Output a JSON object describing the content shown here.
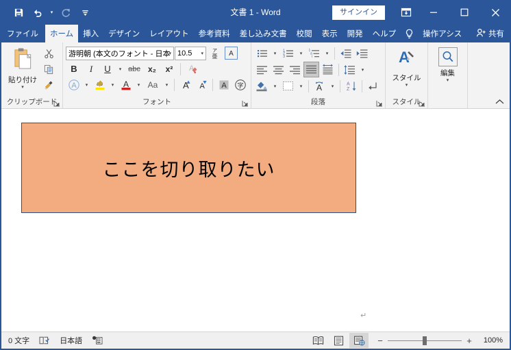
{
  "titlebar": {
    "document_title": "文書 1  -  Word",
    "signin_label": "サインイン",
    "quick_access": [
      {
        "name": "save",
        "icon": "save-icon"
      },
      {
        "name": "undo",
        "icon": "undo-icon"
      },
      {
        "name": "redo",
        "icon": "redo-icon"
      },
      {
        "name": "customize-quick-access",
        "icon": "chevron-down-icon"
      }
    ],
    "window_buttons": {
      "ribbon_display": "ribbon-display-options-icon",
      "minimize": "–",
      "maximize": "❐",
      "close": "✕"
    }
  },
  "tabs": [
    {
      "label": "ファイル",
      "active": false
    },
    {
      "label": "ホーム",
      "active": true
    },
    {
      "label": "挿入",
      "active": false
    },
    {
      "label": "デザイン",
      "active": false
    },
    {
      "label": "レイアウト",
      "active": false
    },
    {
      "label": "参考資料",
      "active": false
    },
    {
      "label": "差し込み文書",
      "active": false
    },
    {
      "label": "校閲",
      "active": false
    },
    {
      "label": "表示",
      "active": false
    },
    {
      "label": "開発",
      "active": false
    },
    {
      "label": "ヘルプ",
      "active": false
    }
  ],
  "tell_me": {
    "label": "操作アシス",
    "icon": "lightbulb-icon"
  },
  "share": {
    "label": "共有",
    "icon": "share-person-icon"
  },
  "ribbon": {
    "groups": [
      {
        "name": "clipboard",
        "label": "クリップボード",
        "paste_label": "貼り付け",
        "buttons": [
          {
            "name": "cut",
            "icon": "scissors-icon"
          },
          {
            "name": "copy",
            "icon": "copy-icon"
          },
          {
            "name": "format-painter",
            "icon": "format-painter-icon"
          }
        ]
      },
      {
        "name": "font",
        "label": "フォント",
        "font_name": "游明朝 (本文のフォント - 日本",
        "font_size": "10.5",
        "buttons": [
          {
            "name": "phonetic-guide",
            "label": "ア亜"
          },
          {
            "name": "character-border",
            "label": "A"
          },
          {
            "name": "bold",
            "label": "B"
          },
          {
            "name": "italic",
            "label": "I"
          },
          {
            "name": "underline",
            "label": "U"
          },
          {
            "name": "strikethrough",
            "label": "abc"
          },
          {
            "name": "subscript",
            "label": "x₂"
          },
          {
            "name": "superscript",
            "label": "x²"
          },
          {
            "name": "clear-formatting",
            "label": "A"
          },
          {
            "name": "text-effects",
            "label": "A"
          },
          {
            "name": "text-highlight-color",
            "label": "ab"
          },
          {
            "name": "font-color",
            "label": "A"
          },
          {
            "name": "change-case",
            "label": "Aa"
          },
          {
            "name": "grow-font",
            "label": "A"
          },
          {
            "name": "shrink-font",
            "label": "A"
          },
          {
            "name": "character-shading",
            "label": "A"
          },
          {
            "name": "enclose-characters",
            "label": "字"
          }
        ]
      },
      {
        "name": "paragraph",
        "label": "段落",
        "buttons": [
          {
            "name": "bullets"
          },
          {
            "name": "numbering"
          },
          {
            "name": "multilevel-list"
          },
          {
            "name": "decrease-indent"
          },
          {
            "name": "increase-indent"
          },
          {
            "name": "align-left"
          },
          {
            "name": "align-center"
          },
          {
            "name": "align-right"
          },
          {
            "name": "justify",
            "selected": true
          },
          {
            "name": "distributed"
          },
          {
            "name": "line-spacing"
          },
          {
            "name": "shading"
          },
          {
            "name": "borders"
          },
          {
            "name": "phonetic-format"
          },
          {
            "name": "sort"
          },
          {
            "name": "show-formatting-marks"
          }
        ]
      },
      {
        "name": "styles",
        "label": "スタイル",
        "button_label": "スタイル"
      },
      {
        "name": "editing",
        "label": "",
        "button_label": "編集"
      }
    ],
    "collapse_icon": "chevron-up-icon"
  },
  "document": {
    "textbox_text": "ここを切り取りたい",
    "textbox_fill": "#F2AC80",
    "textbox_border": "#2B4E86",
    "paragraph_mark": "↵"
  },
  "statusbar": {
    "word_count": "0 文字",
    "proofing_icon": "proofing-icon",
    "language": "日本語",
    "macro_icon": "macro-record-icon",
    "views": [
      {
        "name": "read-mode",
        "active": false
      },
      {
        "name": "print-layout",
        "active": false
      },
      {
        "name": "web-layout",
        "active": true
      }
    ],
    "zoom_minus": "−",
    "zoom_plus": "+",
    "zoom_level": "100%"
  }
}
